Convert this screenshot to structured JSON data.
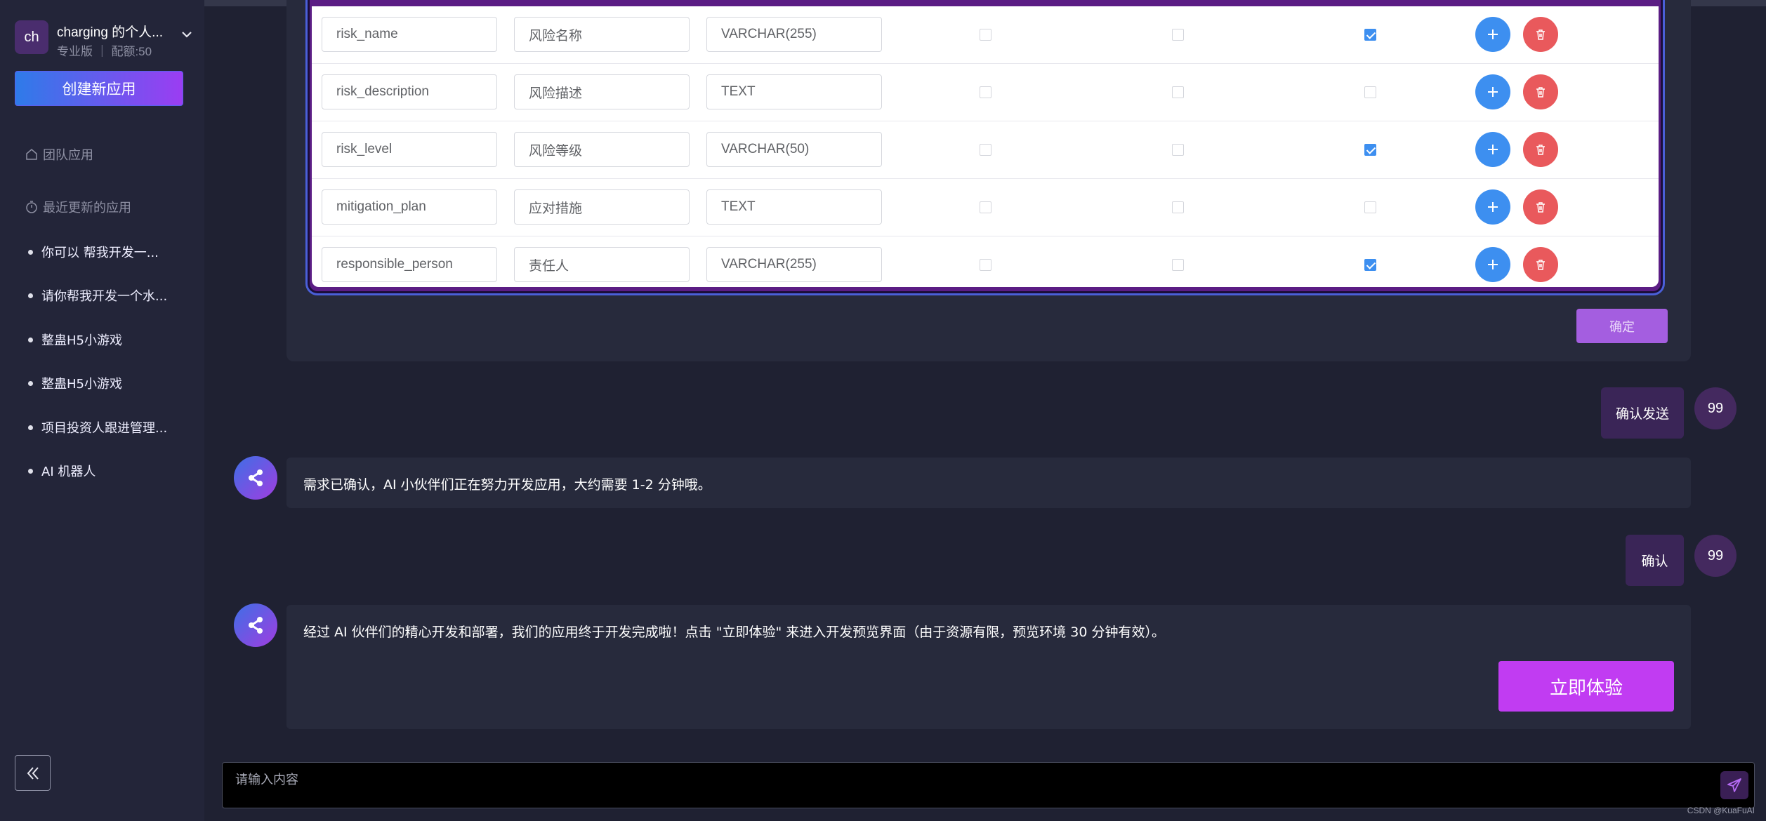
{
  "sidebar": {
    "workspace": {
      "avatar": "ch",
      "name": "charging 的个人...",
      "plan": "专业版 ｜ 配额:50"
    },
    "create_label": "创建新应用",
    "team_apps_label": "团队应用",
    "recent_label": "最近更新的应用",
    "recent_items": [
      {
        "label": "你可以 帮我开发一..."
      },
      {
        "label": "请你帮我开发一个水..."
      },
      {
        "label": "整蛊H5小游戏"
      },
      {
        "label": "整蛊H5小游戏"
      },
      {
        "label": "项目投资人跟进管理..."
      },
      {
        "label": "AI 机器人"
      }
    ]
  },
  "table": {
    "rows": [
      {
        "field": "risk_name",
        "label": "风险名称",
        "type": "VARCHAR(255)",
        "c1": false,
        "c2": false,
        "c3": true
      },
      {
        "field": "risk_description",
        "label": "风险描述",
        "type": "TEXT",
        "c1": false,
        "c2": false,
        "c3": false
      },
      {
        "field": "risk_level",
        "label": "风险等级",
        "type": "VARCHAR(50)",
        "c1": false,
        "c2": false,
        "c3": true
      },
      {
        "field": "mitigation_plan",
        "label": "应对措施",
        "type": "TEXT",
        "c1": false,
        "c2": false,
        "c3": false
      },
      {
        "field": "responsible_person",
        "label": "责任人",
        "type": "VARCHAR(255)",
        "c1": false,
        "c2": false,
        "c3": true
      }
    ],
    "confirm_label": "确定"
  },
  "chat": {
    "user_msg_1": "确认发送",
    "user_avatar": "99",
    "bot_msg_1": "需求已确认，AI 小伙伴们正在努力开发应用，大约需要 1-2 分钟哦。",
    "user_msg_2": "确认",
    "bot_msg_2": "经过 AI 伙伴们的精心开发和部署，我们的应用终于开发完成啦！点击 \"立即体验\" 来进入开发预览界面（由于资源有限，预览环境 30 分钟有效）。",
    "try_label": "立即体验"
  },
  "composer": {
    "placeholder": "请输入内容"
  },
  "watermark": "CSDN @KuaFuAI",
  "colors": {
    "accent_purple": "#c13cf2",
    "accent_blue": "#3d8ff0",
    "danger": "#e9595c",
    "bg": "#1f2132"
  }
}
